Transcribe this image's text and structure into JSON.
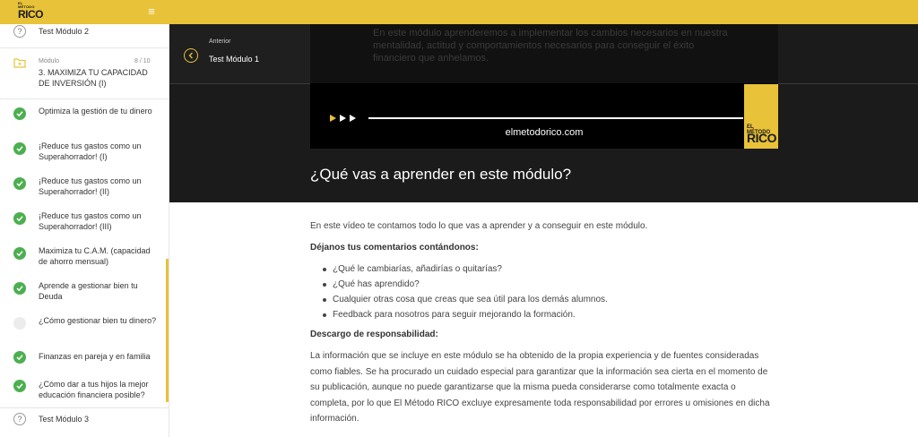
{
  "colors": {
    "accent": "#e8c238",
    "dark": "#1b1b1b",
    "check": "#4caf50"
  },
  "logo": {
    "small": "EL MÉTODO",
    "big": "RICO"
  },
  "topbar": {
    "menu_icon": "hamburger-icon",
    "menu_glyph": "≡"
  },
  "sidebar": {
    "test_top": "Test Módulo 2",
    "module_label": "Módulo",
    "module_count": "8 / 10",
    "module_title": "3. MAXIMIZA TU CAPACIDAD DE INVERSIÓN (I)",
    "lessons": [
      {
        "label": "Optimiza la gestión de tu dinero",
        "status": "done"
      },
      {
        "label": "¡Reduce tus gastos como un Superahorrador! (I)",
        "status": "done"
      },
      {
        "label": "¡Reduce tus gastos como un Superahorrador! (II)",
        "status": "done"
      },
      {
        "label": "¡Reduce tus gastos como un Superahorrador! (III)",
        "status": "done"
      },
      {
        "label": "Maximiza tu C.A.M. (capacidad de ahorro mensual)",
        "status": "done"
      },
      {
        "label": "Aprende a gestionar bien tu Deuda",
        "status": "done"
      },
      {
        "label": "¿Cómo gestionar bien tu dinero?",
        "status": "pending"
      },
      {
        "label": "Finanzas en pareja y en familia",
        "status": "done"
      },
      {
        "label": "¿Cómo dar a tus hijos la mejor educación financiera posible?",
        "status": "done"
      }
    ],
    "test_bottom": "Test Módulo 3"
  },
  "nav": {
    "prev_label": "Anterior",
    "prev_title": "Test Módulo 1"
  },
  "video": {
    "overlay_text": "En este módulo aprenderemos a implementar los cambios necesarios en nuestra mentalidad, actitud y comportamientos necesarios para conseguir el éxito financiero que anhelamos.",
    "url": "elmetodorico.com",
    "logo_small": "EL MÉTODO",
    "logo_big": "RICO"
  },
  "main": {
    "heading": "¿Qué vas a aprender en este módulo?",
    "intro": "En este vídeo te contamos todo lo que vas a aprender y a conseguir en este módulo.",
    "comments_heading": "Déjanos tus comentarios contándonos:",
    "bullets": [
      "¿Qué le cambiarías, añadirías o quitarías?",
      "¿Qué has aprendido?",
      "Cualquier otras cosa que creas que sea útil para los demás alumnos.",
      "Feedback para nosotros para seguir mejorando la formación."
    ],
    "disclaimer_heading": "Descargo de responsabilidad:",
    "disclaimer": "La información que se incluye en este módulo se ha obtenido de la propia experiencia y de fuentes consideradas como fiables. Se ha procurado un cuidado especial para garantizar que la información sea cierta en el momento de su publicación, aunque no puede garantizarse que la misma pueda considerarse como totalmente exacta o completa, por lo que El Método RICO excluye expresamente toda responsabilidad por errores u omisiones en dicha información."
  }
}
